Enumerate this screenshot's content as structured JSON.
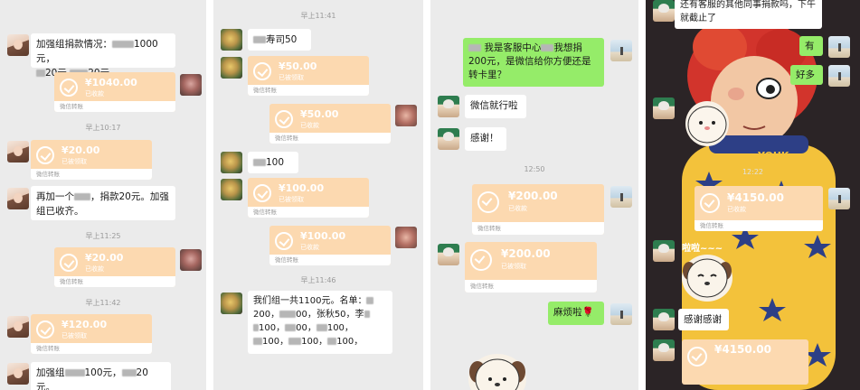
{
  "panel1": {
    "msg1": "加强组捐款情况：",
    "msg1_a": "1000元，",
    "msg1_b": "20元",
    "msg1_c": "20元",
    "t1": {
      "amount": "¥1040.00",
      "status": "已收款",
      "foot": "微信转账"
    },
    "time1": "早上10:17",
    "t2": {
      "amount": "¥20.00",
      "status": "已被领取",
      "foot": "微信转账"
    },
    "msg2": "再加一个",
    "msg2_b": "，捐款20元。加强",
    "msg2_c": "组已收齐。",
    "time2": "早上11:25",
    "t3": {
      "amount": "¥20.00",
      "status": "已收款",
      "foot": "微信转账"
    },
    "time3": "早上11:42",
    "t4": {
      "amount": "¥120.00",
      "status": "已被领取",
      "foot": "微信转账"
    },
    "msg3": "加强组",
    "msg3_b": "100元，",
    "msg3_c": "20",
    "msg3_d": "元。"
  },
  "panel2": {
    "time1": "早上11:41",
    "msg1": "寿司50",
    "t1": {
      "amount": "¥50.00",
      "status": "已被领取",
      "foot": "微信转账"
    },
    "t2": {
      "amount": "¥50.00",
      "status": "已收款",
      "foot": "微信转账"
    },
    "msg2": "100",
    "t3": {
      "amount": "¥100.00",
      "status": "已被领取",
      "foot": "微信转账"
    },
    "t4": {
      "amount": "¥100.00",
      "status": "已收款",
      "foot": "微信转账"
    },
    "time2": "早上11:46",
    "msg3_l1": "我们组一共1100元。名单：",
    "msg3_l2a": "200，",
    "msg3_l2b": "00，张秋50，李",
    "msg3_l3": "100，",
    "msg3_l3b": "00，",
    "msg3_l3c": "100，",
    "msg3_l4": "100，",
    "msg3_l4b": "100，",
    "msg3_l4c": "100，"
  },
  "panel3": {
    "msg1_a": "我是客服中心",
    "msg1_b": "我想捐200元，是微信给你方便还是转卡里？",
    "msg2": "微信就行啦",
    "msg3": "感谢！",
    "time1": "12:50",
    "t1": {
      "amount": "¥200.00",
      "status": "已收款",
      "foot": "微信转账"
    },
    "t2": {
      "amount": "¥200.00",
      "status": "已被领取",
      "foot": "微信转账"
    },
    "msg4": "麻烦啦",
    "msg4_emoji": "🌹"
  },
  "panel4": {
    "msg1_l1": "还有客服的其他同事捐款吗，下午",
    "msg1_l2": "就截止了",
    "reply1": "有",
    "reply2": "好多",
    "time1": "12:22",
    "t1": {
      "amount": "¥4150.00",
      "status": "已收款",
      "foot": "微信转账"
    },
    "sticker_text": "啦啦~~~",
    "msg2": "感谢感谢",
    "t2": {
      "amount": "¥4150.00"
    },
    "poster_text": "YOUK"
  },
  "colors": {
    "transfer": "#fcd9b0",
    "green_bubble": "#95ec69",
    "chat_bg": "#ebebeb"
  }
}
